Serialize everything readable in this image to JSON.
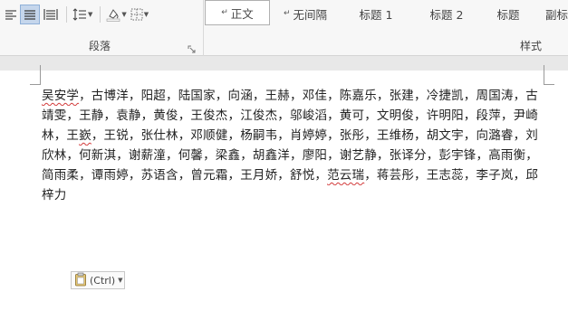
{
  "ribbon": {
    "paragraph_group_label": "段落",
    "styles_group_label": "样式",
    "styles": [
      {
        "label": "正文",
        "mark": "↵",
        "selected": true
      },
      {
        "label": "无间隔",
        "mark": "↵",
        "selected": false
      },
      {
        "label": "标题 1",
        "mark": "",
        "selected": false
      },
      {
        "label": "标题 2",
        "mark": "",
        "selected": false
      },
      {
        "label": "标题",
        "mark": "",
        "selected": false
      },
      {
        "label": "副标",
        "mark": "",
        "selected": false
      }
    ],
    "icons": [
      "align-left-icon",
      "justify-icon",
      "distributed-icon",
      "line-spacing-icon",
      "shading-icon",
      "borders-icon",
      "dialog-launcher-icon"
    ]
  },
  "document": {
    "lines": [
      {
        "pre": "",
        "err": "吴安学",
        "post": "，古博洋，阳超，陆国家，向涵，王赫，邓佳，陈嘉乐，张建，冷捷凯，周国涛，古"
      },
      {
        "pre": "靖雯，王静，袁静，黄俊，王俊杰，江俊杰，邬峻滔，黄可，文明俊，许明阳，段萍，尹崎",
        "err": "",
        "post": ""
      },
      {
        "pre": "林，王",
        "err": "嶔",
        "post": "，王锐，张仕林，邓顺健，杨嗣韦，肖婷婷，张彤，王维杨，胡文宇，向潞睿，刘"
      },
      {
        "pre": "欣林，何新淇，谢薪潼，何馨，梁鑫，胡鑫洋，廖阳，谢艺静，张译分，彭宇锋，高雨衡，",
        "err": "",
        "post": ""
      },
      {
        "pre": "简雨柔，谭雨婷，苏语含，曾元霜，王月娇，舒悦，",
        "err": "范云瑞",
        "post": "，蒋芸彤，王志蕊，李子岚，邱"
      },
      {
        "pre": "梓力",
        "err": "",
        "post": ""
      }
    ],
    "paste_options_label": "(Ctrl)"
  }
}
